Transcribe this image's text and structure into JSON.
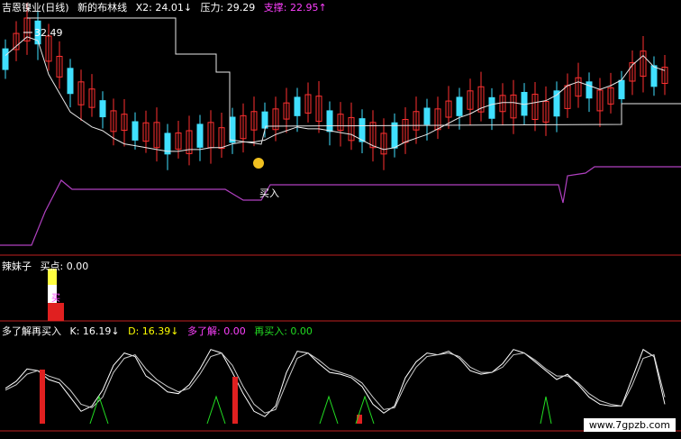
{
  "panel1": {
    "title": "吉恩镍业(日线)",
    "indicator": "新的布林线",
    "x2": "X2: 24.01↓",
    "pressure": "压力: 29.29",
    "support": "支撑: 22.95↑",
    "high_label": "32.49",
    "buy_label": "买入"
  },
  "panel2": {
    "title": "辣妹子",
    "buy_point": "买点: 0.00",
    "bar_label": "买"
  },
  "panel3": {
    "title": "多了解再买入",
    "k": "K: 16.19↓",
    "d": "D: 16.39↓",
    "more": "多了解: 0.00",
    "rebuy": "再买入: 0.00"
  },
  "watermark": "www.7gpzb.com",
  "colors": {
    "up": "#ff3030",
    "down": "#40e0ff",
    "line": "#e8e8e8",
    "support": "#b040c0",
    "axis": "#c02020"
  },
  "chart_data": [
    {
      "type": "line",
      "series": [
        {
          "values": [
            31,
            31.5,
            32,
            31.8,
            30,
            29,
            28,
            27.6,
            27.2,
            27,
            26.6,
            26.3,
            26.2,
            26.1,
            26,
            25.9,
            25.9,
            26,
            26,
            26.1,
            26.1,
            26.3,
            26.4,
            26.4,
            26.5,
            26.8,
            27,
            27.2,
            27.1,
            27.1,
            27.0,
            26.9,
            26.8,
            26.5,
            26.2,
            26.0,
            26.1,
            26.4,
            26.6,
            26.8,
            27.1,
            27.4,
            27.7,
            27.9,
            28.2,
            28.4,
            28.5,
            28.5,
            28.4,
            28.5,
            28.6,
            28.9,
            29.4,
            29.6,
            29.4,
            29.2,
            29.4,
            29.7,
            30.5,
            31.0,
            30.4,
            30.2
          ]
        },
        {
          "values": [
            31.0,
            31.7,
            32.4,
            32.0,
            31.2,
            30.6,
            29.6,
            29.0,
            28.5,
            28.0,
            27.7,
            27.4,
            27.0,
            26.7,
            26.6,
            26.5,
            26.4,
            26.4,
            26.5,
            26.6,
            26.8,
            27.0,
            27.2,
            27.3,
            27.4,
            27.8,
            28.0,
            28.3,
            28.2,
            28.0,
            27.7,
            27.4,
            27.1,
            26.8,
            26.6,
            26.5,
            26.7,
            27.0,
            27.3,
            27.6,
            27.8,
            28.1,
            28.3,
            28.4,
            28.5,
            28.4,
            28.4,
            28.3,
            28.2,
            28.1,
            28.2,
            28.4,
            28.8,
            29.1,
            29.0,
            28.8,
            28.8,
            29.2,
            29.9,
            30.4,
            30.1,
            29.9
          ]
        }
      ]
    },
    {
      "type": "bar",
      "values": [
        0,
        0,
        0,
        0,
        0,
        0,
        0,
        0,
        0,
        0,
        0,
        0,
        0,
        0,
        0,
        0,
        0,
        0,
        0,
        0,
        0,
        0,
        0,
        0,
        1,
        0,
        0,
        0,
        0,
        0,
        0,
        0,
        0,
        0,
        0,
        0,
        0,
        0,
        0,
        0,
        0,
        0,
        0,
        0,
        0,
        0,
        0,
        0,
        0,
        0,
        0,
        0,
        0,
        0,
        0,
        0,
        0,
        0,
        0,
        0,
        0,
        0
      ]
    },
    {
      "type": "line",
      "series": [
        {
          "values": [
            40,
            48,
            62,
            60,
            50,
            46,
            30,
            14,
            20,
            38,
            66,
            80,
            76,
            54,
            46,
            36,
            34,
            44,
            62,
            84,
            80,
            58,
            34,
            14,
            8,
            20,
            58,
            82,
            80,
            68,
            58,
            56,
            52,
            42,
            22,
            12,
            20,
            52,
            70,
            80,
            78,
            82,
            74,
            60,
            56,
            58,
            68,
            84,
            80,
            70,
            60,
            50,
            56,
            44,
            30,
            22,
            20,
            20,
            52,
            84,
            76,
            22
          ]
        },
        {
          "values": [
            38,
            44,
            56,
            60,
            54,
            50,
            38,
            22,
            18,
            30,
            58,
            74,
            78,
            62,
            50,
            42,
            36,
            40,
            56,
            76,
            80,
            66,
            42,
            22,
            12,
            16,
            46,
            74,
            80,
            72,
            62,
            58,
            54,
            46,
            30,
            16,
            18,
            44,
            64,
            76,
            78,
            80,
            76,
            64,
            58,
            58,
            64,
            78,
            80,
            72,
            62,
            54,
            54,
            46,
            34,
            26,
            22,
            20,
            44,
            74,
            78,
            30
          ]
        }
      ]
    }
  ]
}
